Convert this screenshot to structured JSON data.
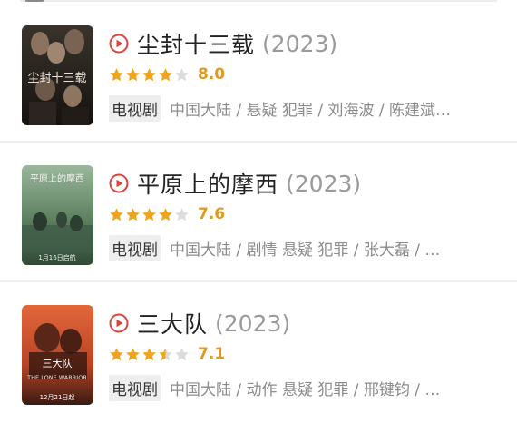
{
  "colors": {
    "star_filled": "#f0a41c",
    "star_empty": "#dcdcdc",
    "score": "#e09a1c",
    "play": "#d9453c"
  },
  "items": [
    {
      "title": "尘封十三载",
      "year": "(2023)",
      "rating_stars": 4,
      "score": "8.0",
      "tag": "电视剧",
      "meta": "中国大陆 / 悬疑 犯罪 / 刘海波 / 陈建斌…",
      "poster_text": "尘封十三载",
      "poster_colors": [
        "#2a2622",
        "#1a1714",
        "#5b3f2e"
      ]
    },
    {
      "title": "平原上的摩西",
      "year": "(2023)",
      "rating_stars": 4,
      "score": "7.6",
      "tag": "电视剧",
      "meta": "中国大陆 / 剧情 悬疑 犯罪 / 张大磊 / …",
      "poster_text": "平原上的摩西",
      "poster_subtext": "1月16日启航",
      "poster_colors": [
        "#5d7f5f",
        "#2f4a36",
        "#8aa58a"
      ]
    },
    {
      "title": "三大队",
      "year": "(2023)",
      "rating_stars": 3.5,
      "score": "7.1",
      "tag": "电视剧",
      "meta": "中国大陆 / 动作 悬疑 犯罪 / 邢键钧 / …",
      "poster_text": "三大队",
      "poster_subtext": "THE LONE WARRIOR",
      "poster_date": "12月21日起",
      "poster_colors": [
        "#b84425",
        "#3a1a12",
        "#e2673a"
      ]
    }
  ]
}
